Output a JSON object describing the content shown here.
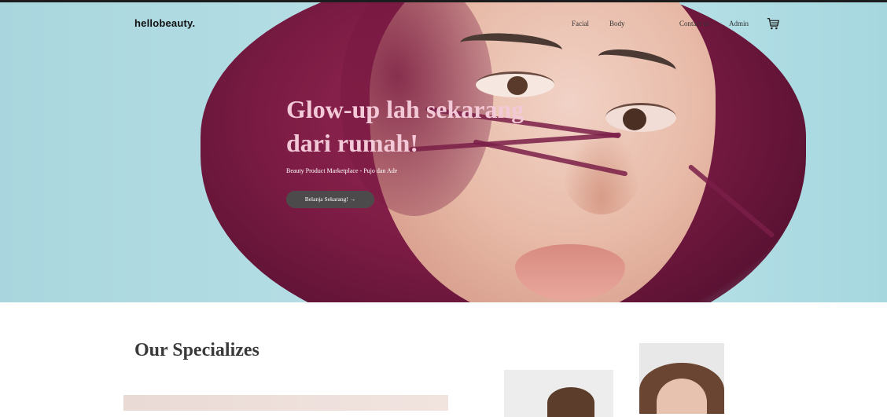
{
  "brand": {
    "logo_text": "hellobeauty."
  },
  "nav": {
    "items": [
      "Facial",
      "Body",
      "Contact us",
      "Admin"
    ],
    "cart_icon": "cart-icon"
  },
  "hero": {
    "title_line1": "Glow-up lah sekarang",
    "title_line2": "dari rumah!",
    "subtitle": "Beauty Product Marketplace - Pujo dan Ade",
    "cta_label": "Belanja Sekarang! →"
  },
  "specializes": {
    "title": "Our Specializes"
  },
  "colors": {
    "hero_title": "#f3c9d8",
    "cta_bg": "#4d4a4b",
    "hero_bg": "#b4dde4"
  }
}
